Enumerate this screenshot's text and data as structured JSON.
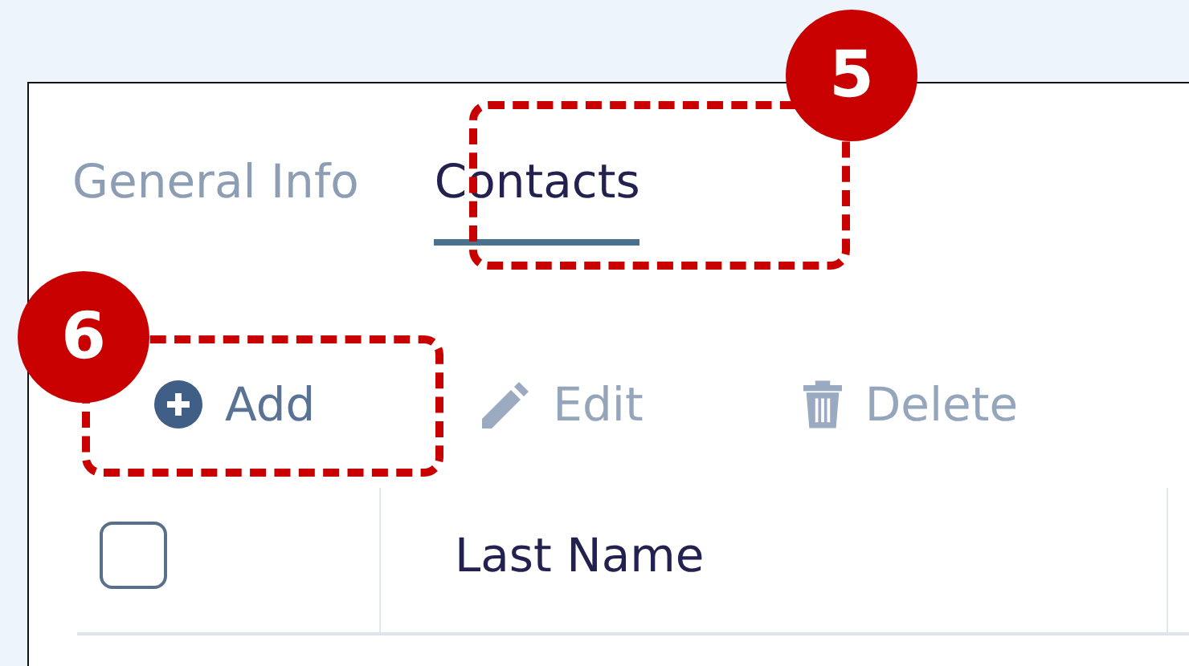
{
  "tabs": [
    {
      "label": "General Info",
      "selected": false
    },
    {
      "label": "Contacts",
      "selected": true
    }
  ],
  "toolbar": [
    {
      "kind": "add",
      "label": "Add",
      "disabled": false
    },
    {
      "kind": "edit",
      "label": "Edit",
      "disabled": true
    },
    {
      "kind": "delete",
      "label": "Delete",
      "disabled": true
    }
  ],
  "table": {
    "select_all": {
      "checked": false
    },
    "columns": [
      "Last Name"
    ]
  },
  "callouts": [
    {
      "number": "5"
    },
    {
      "number": "6"
    }
  ]
}
